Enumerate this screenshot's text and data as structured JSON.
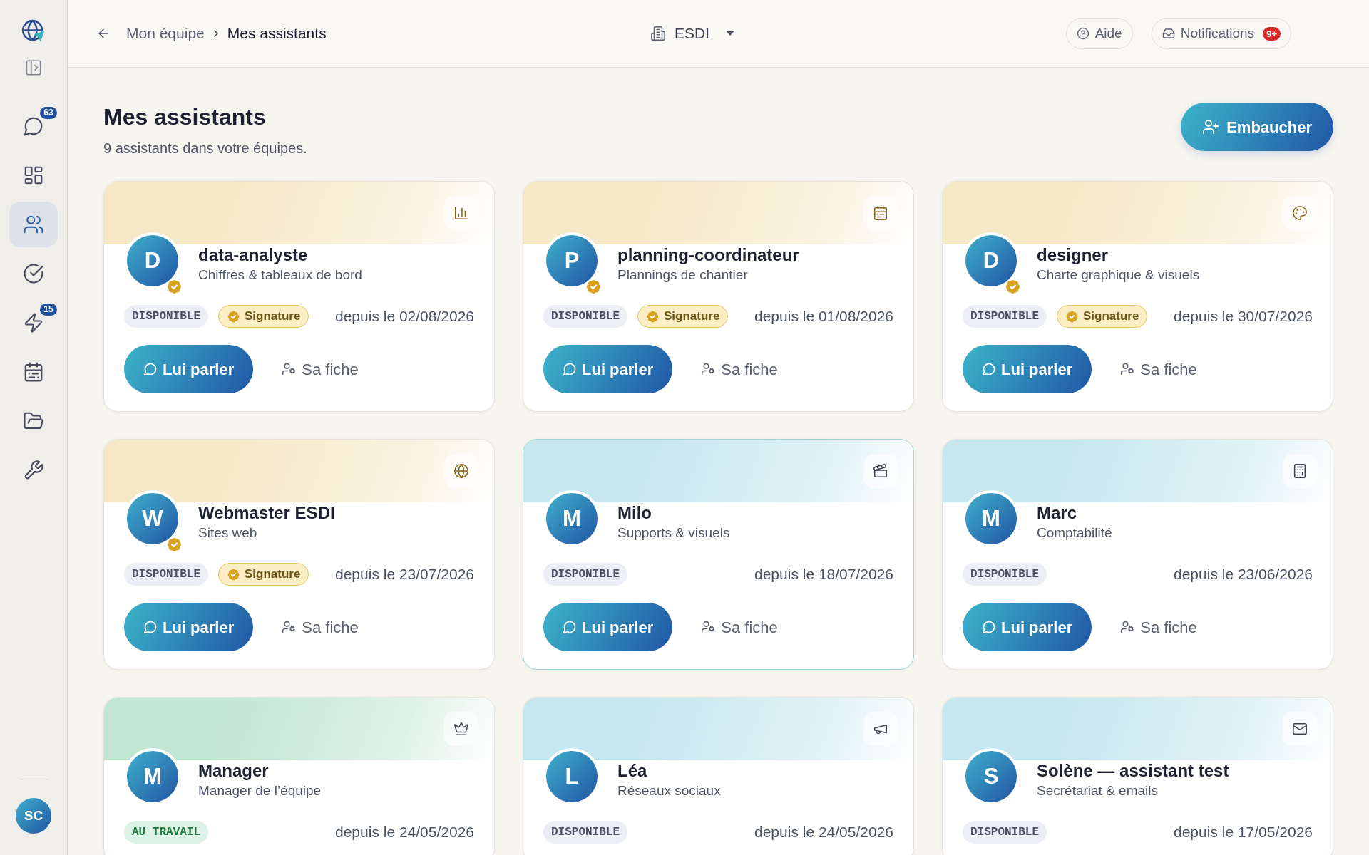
{
  "sidebar": {
    "items": [
      {
        "selected": false,
        "badge": "63"
      },
      {
        "selected": false
      },
      {
        "selected": true
      },
      {
        "selected": false
      },
      {
        "selected": false,
        "badge": "15"
      },
      {
        "selected": false
      },
      {
        "selected": false
      },
      {
        "selected": false
      }
    ],
    "user": {
      "initials": "SC"
    }
  },
  "topbar": {
    "breadcrumb": {
      "parent": "Mon équipe",
      "current": "Mes assistants"
    },
    "workspace": "ESDI",
    "help": "Aide",
    "notifications": {
      "label": "Notifications",
      "badge": "9+"
    }
  },
  "page": {
    "title": "Mes assistants",
    "subtitle": "9 assistants dans votre équipes.",
    "hire_button": "Embaucher"
  },
  "assistants": [
    {
      "initial": "D",
      "name": "data-analyste",
      "role": "Chiffres & tableaux de bord",
      "status": {
        "label": "DISPONIBLE",
        "kind": "available"
      },
      "signature": "Signature",
      "since": "depuis le 02/08/2026",
      "color": "#f5e8c6",
      "selected": false,
      "talk_button": "Lui parler",
      "profile_link": "Sa fiche"
    },
    {
      "initial": "P",
      "name": "planning-coordinateur",
      "role": "Plannings de chantier",
      "status": {
        "label": "DISPONIBLE",
        "kind": "available"
      },
      "signature": "Signature",
      "since": "depuis le 01/08/2026",
      "color": "#f5e8c6",
      "selected": false,
      "talk_button": "Lui parler",
      "profile_link": "Sa fiche"
    },
    {
      "initial": "D",
      "name": "designer",
      "role": "Charte graphique & visuels",
      "status": {
        "label": "DISPONIBLE",
        "kind": "available"
      },
      "signature": "Signature",
      "since": "depuis le 30/07/2026",
      "color": "#f5e8c6",
      "selected": false,
      "talk_button": "Lui parler",
      "profile_link": "Sa fiche"
    },
    {
      "initial": "W",
      "name": "Webmaster ESDI",
      "role": "Sites web",
      "status": {
        "label": "DISPONIBLE",
        "kind": "available"
      },
      "signature": "Signature",
      "since": "depuis le 23/07/2026",
      "color": "#f5e8c6",
      "selected": false,
      "talk_button": "Lui parler",
      "profile_link": "Sa fiche"
    },
    {
      "initial": "M",
      "name": "Milo",
      "role": "Supports & visuels",
      "status": {
        "label": "DISPONIBLE",
        "kind": "available"
      },
      "since": "depuis le 18/07/2026",
      "color": "#c6e7ee",
      "selected": true,
      "talk_button": "Lui parler",
      "profile_link": "Sa fiche"
    },
    {
      "initial": "M",
      "name": "Marc",
      "role": "Comptabilité",
      "status": {
        "label": "DISPONIBLE",
        "kind": "available"
      },
      "since": "depuis le 23/06/2026",
      "color": "#c6e7ee",
      "selected": false,
      "talk_button": "Lui parler",
      "profile_link": "Sa fiche"
    },
    {
      "initial": "M",
      "name": "Manager",
      "role": "Manager de l’équipe",
      "status": {
        "label": "AU TRAVAIL",
        "kind": "working"
      },
      "since": "depuis le 24/05/2026",
      "color": "#c2e6d4",
      "selected": false
    },
    {
      "initial": "L",
      "name": "Léa",
      "role": "Réseaux sociaux",
      "status": {
        "label": "DISPONIBLE",
        "kind": "available"
      },
      "since": "depuis le 24/05/2026",
      "color": "#c6e7ee",
      "selected": false
    },
    {
      "initial": "S",
      "name": "Solène — assistant test",
      "role": "Secrétariat & emails",
      "status": {
        "label": "DISPONIBLE",
        "kind": "available"
      },
      "since": "depuis le 17/05/2026",
      "color": "#c6e7ee",
      "selected": false
    }
  ]
}
